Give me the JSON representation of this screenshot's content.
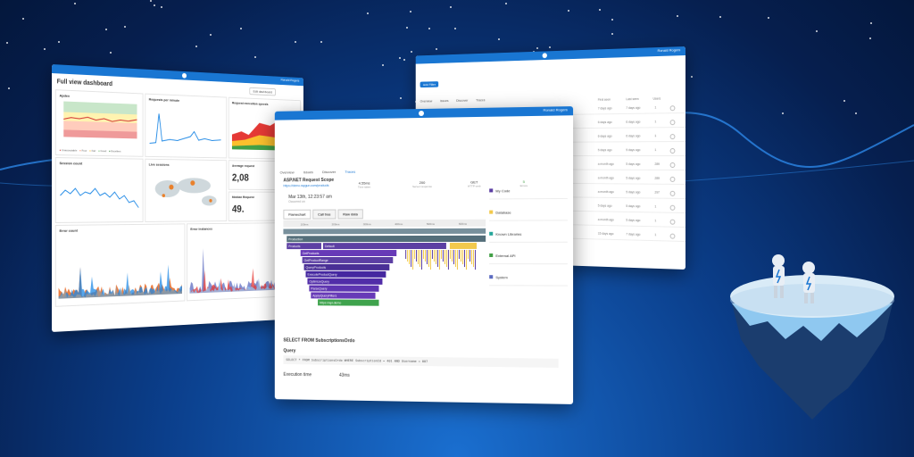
{
  "colors": {
    "brand": "#1976d2",
    "accent": "#ef6c00",
    "purple": "#5c3fa3",
    "green": "#3fa34d",
    "yellow": "#f2c94c"
  },
  "left_window": {
    "user": "Ronald Rogers",
    "title": "Full view dashboard",
    "edit_button": "Edit dashboard",
    "panels": {
      "apdex": "Apdex",
      "rpm": "Requests per minute",
      "exec": "Request execution speeds",
      "session_count": "Session count",
      "live_sessions": "Live sessions",
      "error_count": "Error count",
      "error_instances": "Error instances",
      "average": "Average request",
      "average_value": "2,08",
      "median": "Median Request",
      "median_value": "49."
    },
    "apdex_legend": [
      "Unacceptable",
      "Poor",
      "Fair",
      "Good",
      "Excellent"
    ]
  },
  "right_window": {
    "user": "Ronald Rogers",
    "tabs": [
      "Overview",
      "Issues",
      "Discover",
      "Traces"
    ],
    "view_button": "Add Filter",
    "status_tabs": [
      {
        "label": "Active",
        "count": "24"
      },
      {
        "label": "Resolved",
        "count": "4"
      },
      {
        "label": "Ignored",
        "count": "1"
      },
      {
        "label": "Permanently ignored",
        "count": "0"
      }
    ],
    "my_issues": "My Issues",
    "col_first": "First seen",
    "col_last": "Last seen",
    "col_users": "Users",
    "rows": [
      {
        "first": "7 days ago",
        "last": "7 days ago",
        "users": "1"
      },
      {
        "first": "6 days ago",
        "last": "6 days ago",
        "users": "1"
      },
      {
        "first": "6 days ago",
        "last": "6 days ago",
        "users": "1"
      },
      {
        "first": "5 days ago",
        "last": "5 days ago",
        "users": "1"
      },
      {
        "first": "a month ago",
        "last": "5 days ago",
        "users": "289"
      },
      {
        "first": "a month ago",
        "last": "5 days ago",
        "users": "289"
      },
      {
        "first": "a month ago",
        "last": "5 days ago",
        "users": "297"
      },
      {
        "first": "5 days ago",
        "last": "5 days ago",
        "users": "1"
      },
      {
        "first": "a month ago",
        "last": "5 days ago",
        "users": "1"
      },
      {
        "first": "15 days ago",
        "last": "7 days ago",
        "users": "1"
      }
    ]
  },
  "front_window": {
    "user": "Ronald Rogers",
    "tabs": [
      "Overview",
      "Issues",
      "Discover",
      "Traces"
    ],
    "trace_title": "ASP.NET Request Scope",
    "trace_url": "https://demo.raygun.com/products",
    "date": "Mar 13th, 12:23:57 am",
    "date_sub": "Occurred on",
    "stat1": "4.55ms",
    "stat1_label": "Time taken",
    "stat2": "200",
    "stat2_label": "Server response",
    "stat3": "GET",
    "stat3_label": "HTTP verb",
    "stat4": "5",
    "stat4_label": "Errors",
    "view_tabs": [
      "Flamechart",
      "Call tree",
      "Raw data"
    ],
    "flame_labels": [
      "Production",
      "Products",
      "Default",
      "GetProducts",
      "GetProductRange",
      "QueryProducts",
      "ExecuteProductQuery",
      "OptimizeQuery",
      "ParseQuery",
      "ApplyQueryFilters",
      "https://api.demo"
    ],
    "sidebar": [
      "My Code",
      "Database",
      "Known Libraries",
      "External API",
      "System"
    ],
    "query_title": "SELECT FROM SubscriptionsOrdo",
    "query_label": "Query",
    "query_text": "SELECT * FROM SubscriptionsOrdo WHERE SubscriptionId = 401 AND Username = 007",
    "exec_label": "Execution time",
    "exec_value": "43ms",
    "timeline_ticks": [
      "100ms",
      "200ms",
      "300ms",
      "400ms",
      "500ms",
      "600ms"
    ]
  }
}
